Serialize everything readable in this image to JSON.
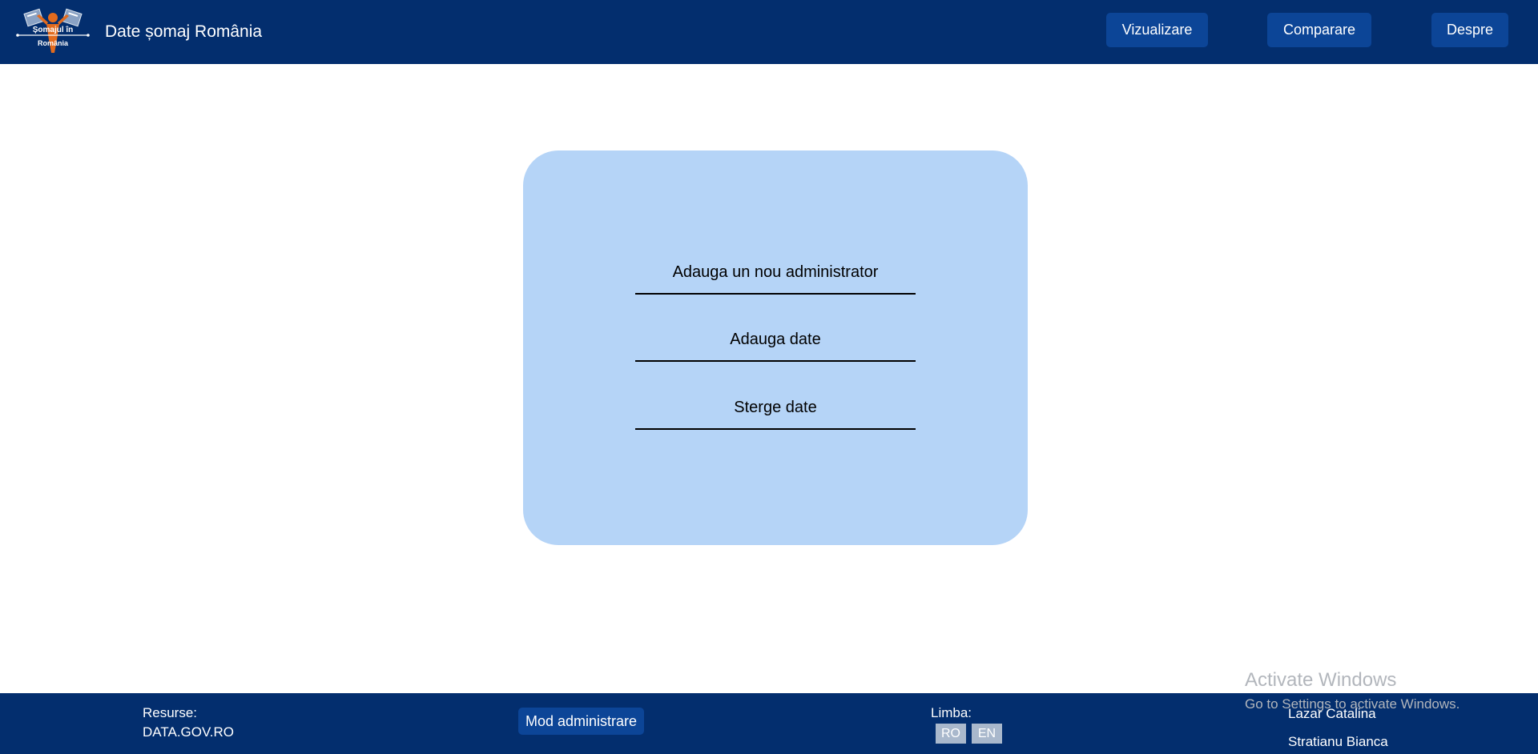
{
  "header": {
    "logo_text_line1": "Șomajul în",
    "logo_text_line2": "România",
    "title": "Date șomaj România",
    "nav": {
      "vizualizare": "Vizualizare",
      "comparare": "Comparare",
      "despre": "Despre"
    }
  },
  "admin_menu": {
    "items": [
      "Adauga un nou administrator",
      "Adauga date",
      "Sterge date"
    ]
  },
  "footer": {
    "resources_label": "Resurse:",
    "resources_link": "DATA.GOV.RO",
    "admin_button": "Mod administrare",
    "language_label": "Limba:",
    "languages": [
      "RO",
      "EN"
    ],
    "authors": [
      "Lazar Catalina",
      "Stratianu Bianca"
    ]
  },
  "watermark": {
    "title": "Activate Windows",
    "subtitle": "Go to Settings to activate Windows."
  },
  "colors": {
    "header_bg": "#032e6e",
    "button_bg": "#0c4597",
    "card_bg": "#b5d4f7",
    "lang_button_bg": "#a9b8cc"
  }
}
